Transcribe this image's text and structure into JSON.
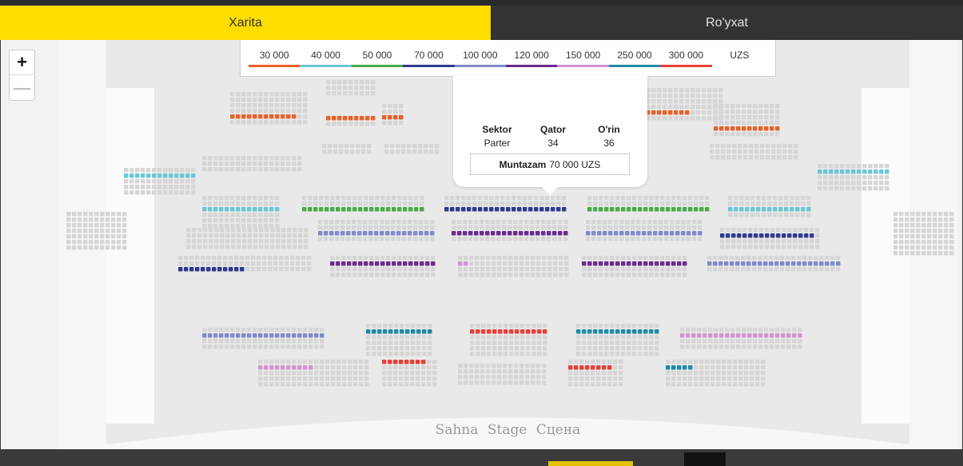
{
  "tabs": {
    "map": "Xarita",
    "list": "Ro'yxat"
  },
  "zoom": {
    "in": "+",
    "out": "—"
  },
  "legend": {
    "items": [
      {
        "label": "30 000",
        "color": "#e8622a"
      },
      {
        "label": "40 000",
        "color": "#6cc7d7"
      },
      {
        "label": "50 000",
        "color": "#4aaa4a"
      },
      {
        "label": "70 000",
        "color": "#2e3b8e"
      },
      {
        "label": "100 000",
        "color": "#8089c9"
      },
      {
        "label": "120 000",
        "color": "#6c2a8f"
      },
      {
        "label": "150 000",
        "color": "#d592d0"
      },
      {
        "label": "250 000",
        "color": "#1f8aa5"
      },
      {
        "label": "300 000",
        "color": "#e8403a"
      }
    ],
    "currency": "UZS"
  },
  "tooltip": {
    "sector_label": "Sektor",
    "sector_value": "Parter",
    "row_label": "Qator",
    "row_value": "34",
    "seat_label": "O'rin",
    "seat_value": "36",
    "category": "Muntazam",
    "price": "70 000 UZS"
  },
  "stage": "Sahna  Stage  Сцена",
  "seat_colors": {
    "grey": "#d6d6d6",
    "orange": "#e8622a",
    "cyan": "#6cc7d7",
    "green": "#4aaa4a",
    "navy": "#2e3b8e",
    "lavender": "#8089c9",
    "purple": "#6c2a8f",
    "pink": "#d592d0",
    "teal": "#1f8aa5",
    "red": "#e8403a"
  }
}
